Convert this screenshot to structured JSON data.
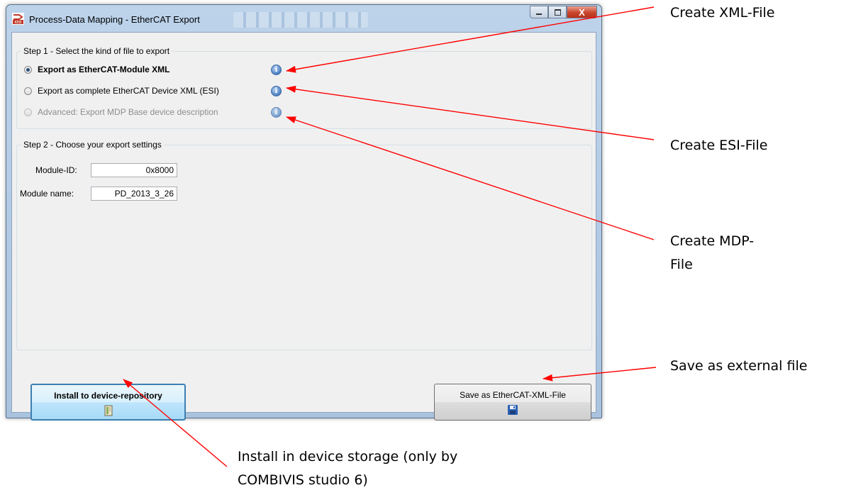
{
  "window": {
    "title": "Process-Data Mapping - EtherCAT Export",
    "controls": {
      "minimize_icon": "minimize-icon",
      "maximize_icon": "maximize-icon",
      "close_label": "X"
    }
  },
  "step1": {
    "label": "Step 1 - Select the kind of file to export",
    "options": [
      {
        "label": "Export as EtherCAT-Module XML",
        "checked": true,
        "enabled": true
      },
      {
        "label": "Export as complete EtherCAT Device XML (ESI)",
        "checked": false,
        "enabled": true
      },
      {
        "label": "Advanced: Export MDP Base device description",
        "checked": false,
        "enabled": false
      }
    ]
  },
  "step2": {
    "label": "Step 2 - Choose your export settings",
    "module_id_label": "Module-ID:",
    "module_id_value": "0x8000",
    "module_name_label": "Module name:",
    "module_name_value": "PD_2013_3_26"
  },
  "buttons": {
    "install_label": "Install to device-repository",
    "save_label": "Save as EtherCAT-XML-File"
  },
  "annotations": {
    "xml_file": "Create XML-File",
    "esi_file": "Create ESI-File",
    "mdp_file_line1": "Create MDP-",
    "mdp_file_line2": "File",
    "external_file": "Save as external file",
    "install_line1": "Install in device storage (only by",
    "install_line2": "COMBIVIS studio 6)"
  },
  "colors": {
    "arrow": "#ff0000",
    "button_focus_border": "#3c7fb1"
  }
}
